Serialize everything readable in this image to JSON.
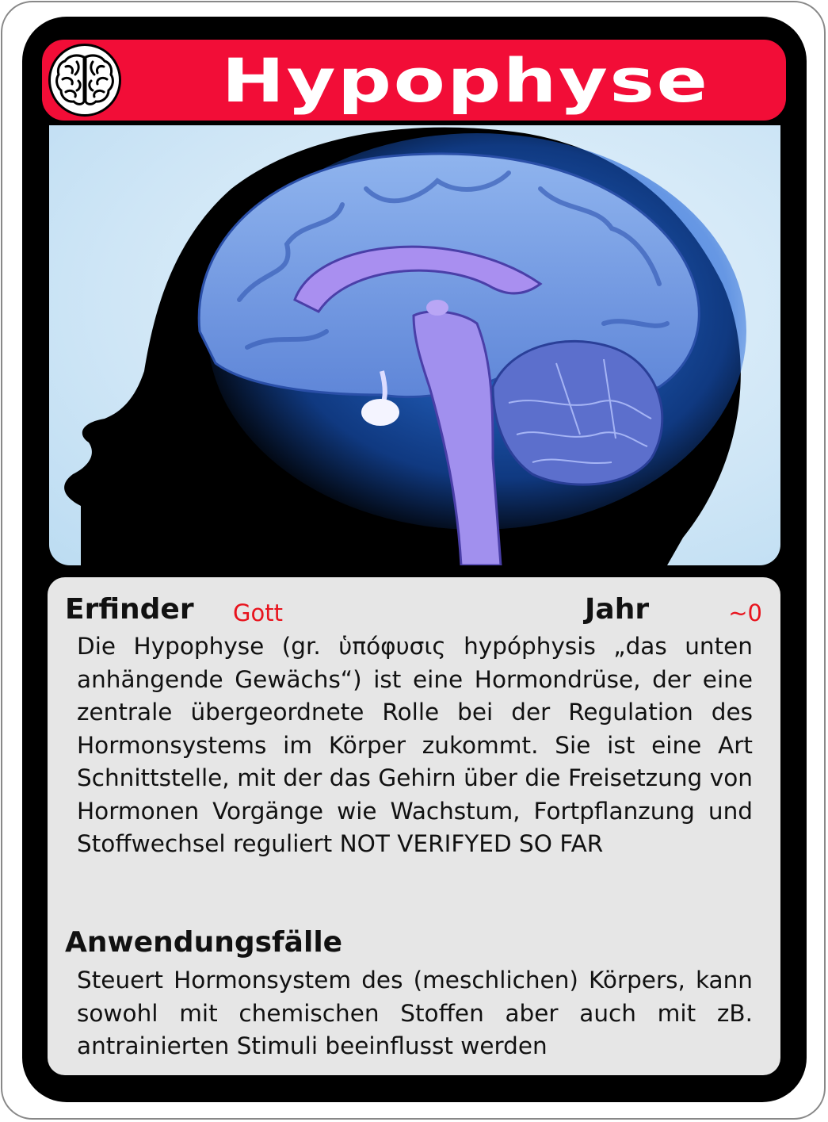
{
  "card": {
    "title": "Hypophyse",
    "colors": {
      "title_bar": "#f20d37",
      "frame": "#000000",
      "panel": "#e6e6e6",
      "accent_value": "#e8131d"
    },
    "title_icon": "brain-icon",
    "image": "brain-sagittal-illustration"
  },
  "info": {
    "inventor_label": "Erfinder",
    "inventor_value": "Gott",
    "year_label": "Jahr",
    "year_value": "~0",
    "description": "Die Hypophyse (gr. ὑπόφυσις hypóphysis „das unten anhängende Gewächs“) ist eine Hormondrüse, der eine zentrale übergeordnete Rolle bei der Regulation des Hormonsystems im Körper zukommt. Sie ist eine Art Schnittstelle, mit der das Gehirn über die Freisetzung von Hormonen Vorgänge wie Wachstum, Fortpflanzung und Stoffwechsel reguliert NOT VERIFYED SO FAR",
    "usecases_label": "Anwendungsfälle",
    "usecases_text": "Steuert Hormonsystem des (meschlichen) Körpers, kann sowohl mit chemischen Stoffen aber auch mit zB. antrainierten Stimuli beeinflusst werden"
  }
}
